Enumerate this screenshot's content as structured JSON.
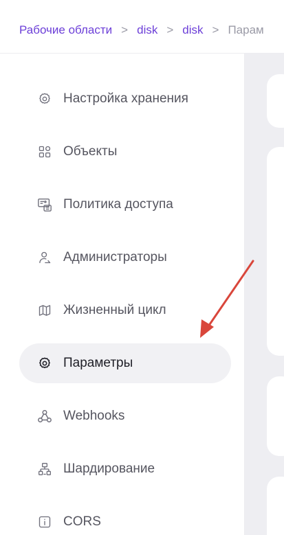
{
  "breadcrumb": {
    "items": [
      "Рабочие области",
      "disk",
      "disk"
    ],
    "separator": ">",
    "current": "Парам"
  },
  "sidebar": {
    "items": [
      {
        "label": "Настройка хранения",
        "icon": "gear-icon"
      },
      {
        "label": "Объекты",
        "icon": "objects-grid-icon"
      },
      {
        "label": "Политика доступа",
        "icon": "access-policy-icon"
      },
      {
        "label": "Администраторы",
        "icon": "user-admin-icon"
      },
      {
        "label": "Жизненный цикл",
        "icon": "map-icon"
      },
      {
        "label": "Параметры",
        "icon": "gear-icon",
        "active": true
      },
      {
        "label": "Webhooks",
        "icon": "webhook-icon"
      },
      {
        "label": "Шардирование",
        "icon": "sharding-icon"
      },
      {
        "label": "CORS",
        "icon": "info-icon"
      }
    ]
  },
  "colors": {
    "accent": "#6c3fd8",
    "active_bg": "#f1f1f4",
    "content_bg": "#eeeef2",
    "annotation_arrow": "#d9463b"
  }
}
